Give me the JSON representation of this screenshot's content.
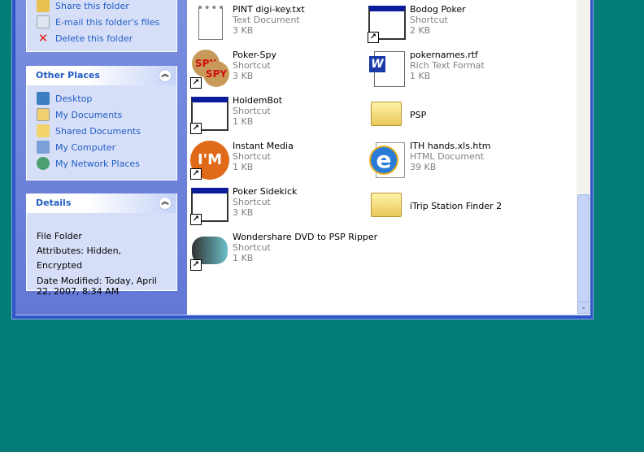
{
  "tasks": {
    "items": [
      {
        "label": "Share this folder",
        "icon": "share-folder-icon"
      },
      {
        "label": "E-mail this folder's files",
        "icon": "email-icon"
      },
      {
        "label": "Delete this folder",
        "icon": "delete-icon"
      }
    ]
  },
  "other_places": {
    "title": "Other Places",
    "items": [
      {
        "label": "Desktop"
      },
      {
        "label": "My Documents"
      },
      {
        "label": "Shared Documents"
      },
      {
        "label": "My Computer"
      },
      {
        "label": "My Network Places"
      }
    ]
  },
  "details": {
    "title": "Details",
    "type": "File Folder",
    "attributes": "Attributes: Hidden, Encrypted",
    "modified": "Date Modified: Today, April 22, 2007, 8:34 AM"
  },
  "files": [
    {
      "name": "PINT digi-key.txt",
      "type": "Text Document",
      "size": "3 KB",
      "icon": "text-document-icon"
    },
    {
      "name": "Bodog Poker",
      "type": "Shortcut",
      "size": "2 KB",
      "icon": "application-shortcut-icon"
    },
    {
      "name": "Poker-Spy",
      "type": "Shortcut",
      "size": "3 KB",
      "icon": "poker-spy-icon"
    },
    {
      "name": "pokernames.rtf",
      "type": "Rich Text Format",
      "size": "1 KB",
      "icon": "word-document-icon"
    },
    {
      "name": "HoldemBot",
      "type": "Shortcut",
      "size": "1 KB",
      "icon": "application-shortcut-icon"
    },
    {
      "name": "PSP",
      "icon": "folder-icon"
    },
    {
      "name": "Instant Media",
      "type": "Shortcut",
      "size": "1 KB",
      "icon": "instant-media-icon"
    },
    {
      "name": "ITH hands.xls.htm",
      "type": "HTML Document",
      "size": "39 KB",
      "icon": "ie-document-icon"
    },
    {
      "name": "Poker Sidekick",
      "type": "Shortcut",
      "size": "3 KB",
      "icon": "application-shortcut-icon"
    },
    {
      "name": "iTrip Station Finder 2",
      "icon": "folder-icon"
    },
    {
      "name": "Wondershare DVD to PSP Ripper",
      "type": "Shortcut",
      "size": "1 KB",
      "icon": "wondershare-icon"
    }
  ],
  "icons": {
    "spy_text": "SPY",
    "im_text": "I'M",
    "word_text": "W",
    "ie_text": "e",
    "shortcut": "↗",
    "chevron": "︽",
    "down": "⌄"
  }
}
